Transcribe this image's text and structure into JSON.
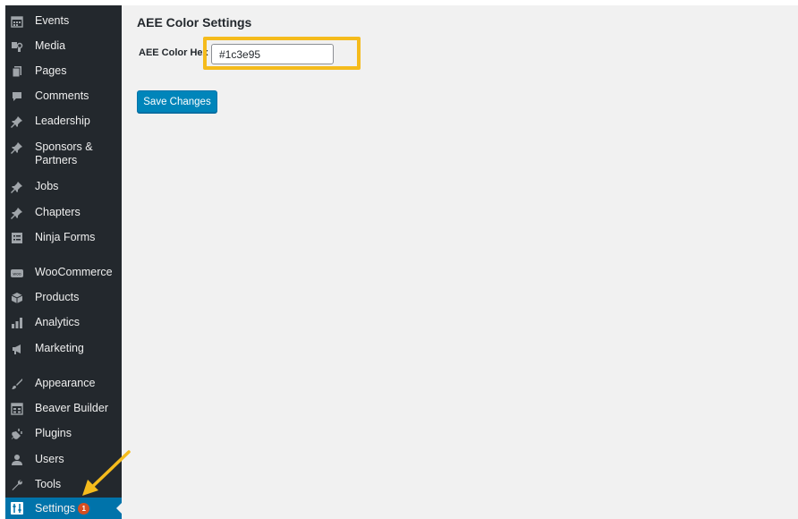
{
  "sidebar": {
    "items": [
      {
        "label": "Events",
        "icon": "calendar-icon"
      },
      {
        "label": "Media",
        "icon": "media-icon"
      },
      {
        "label": "Pages",
        "icon": "pages-icon"
      },
      {
        "label": "Comments",
        "icon": "comment-icon"
      },
      {
        "label": "Leadership",
        "icon": "pin-icon"
      },
      {
        "label": "Sponsors & Partners",
        "icon": "pin-icon"
      },
      {
        "label": "Jobs",
        "icon": "pin-icon"
      },
      {
        "label": "Chapters",
        "icon": "pin-icon"
      },
      {
        "label": "Ninja Forms",
        "icon": "form-icon"
      },
      {
        "label": "WooCommerce",
        "icon": "woo-icon"
      },
      {
        "label": "Products",
        "icon": "box-icon"
      },
      {
        "label": "Analytics",
        "icon": "bar-chart-icon"
      },
      {
        "label": "Marketing",
        "icon": "megaphone-icon"
      },
      {
        "label": "Appearance",
        "icon": "brush-icon"
      },
      {
        "label": "Beaver Builder",
        "icon": "grid-icon"
      },
      {
        "label": "Plugins",
        "icon": "plug-icon"
      },
      {
        "label": "Users",
        "icon": "user-icon"
      },
      {
        "label": "Tools",
        "icon": "wrench-icon"
      }
    ],
    "active": {
      "label": "Settings",
      "badge": "1",
      "icon": "settings-icon"
    }
  },
  "main": {
    "title": "AEE Color Settings",
    "field_label": "AEE Color Hex",
    "field_value": "#1c3e95",
    "save_label": "Save Changes"
  },
  "colors": {
    "sidebar_bg": "#23282d",
    "active_bg": "#0073aa",
    "button_bg": "#0085ba",
    "highlight": "#f5bb1c",
    "badge": "#d54e21"
  }
}
